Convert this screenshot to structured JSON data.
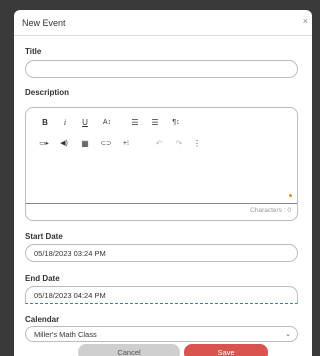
{
  "dialog": {
    "title": "New Event",
    "close_glyph": "×"
  },
  "title_field": {
    "label": "Title",
    "value": ""
  },
  "description": {
    "label": "Description",
    "toolbar_row1": [
      {
        "name": "bold-button",
        "glyph": "B"
      },
      {
        "name": "italic-button",
        "glyph": "i"
      },
      {
        "name": "underline-button",
        "glyph": "U"
      },
      {
        "name": "font-size-button",
        "glyph": "A↕"
      },
      {
        "name": "align-left-button",
        "glyph": "☰"
      },
      {
        "name": "list-button",
        "glyph": "☰"
      },
      {
        "name": "paragraph-button",
        "glyph": "¶↕"
      }
    ],
    "toolbar_row2": [
      {
        "name": "video-button",
        "glyph": "▭▸"
      },
      {
        "name": "audio-button",
        "glyph": "◀)"
      },
      {
        "name": "table-button",
        "glyph": "▦"
      },
      {
        "name": "link-button",
        "glyph": "⊂⊃"
      },
      {
        "name": "insert-button",
        "glyph": "+⁝"
      },
      {
        "name": "undo-button",
        "glyph": "↶"
      },
      {
        "name": "redo-button",
        "glyph": "↷"
      },
      {
        "name": "more-button",
        "glyph": "⋮"
      }
    ],
    "char_count_label": "Characters : 0"
  },
  "start_date": {
    "label": "Start Date",
    "value": "05/18/2023 03:24 PM"
  },
  "end_date": {
    "label": "End Date",
    "value": "05/18/2023 04:24 PM"
  },
  "calendar": {
    "label": "Calendar",
    "value": "Miller's Math Class"
  },
  "buttons": {
    "cancel": "Cancel",
    "save": "Save"
  },
  "colors": {
    "save": "#d9534f",
    "cancel": "#cfcfcf",
    "accent": "#f08a24",
    "focus": "#3a7bd5"
  }
}
